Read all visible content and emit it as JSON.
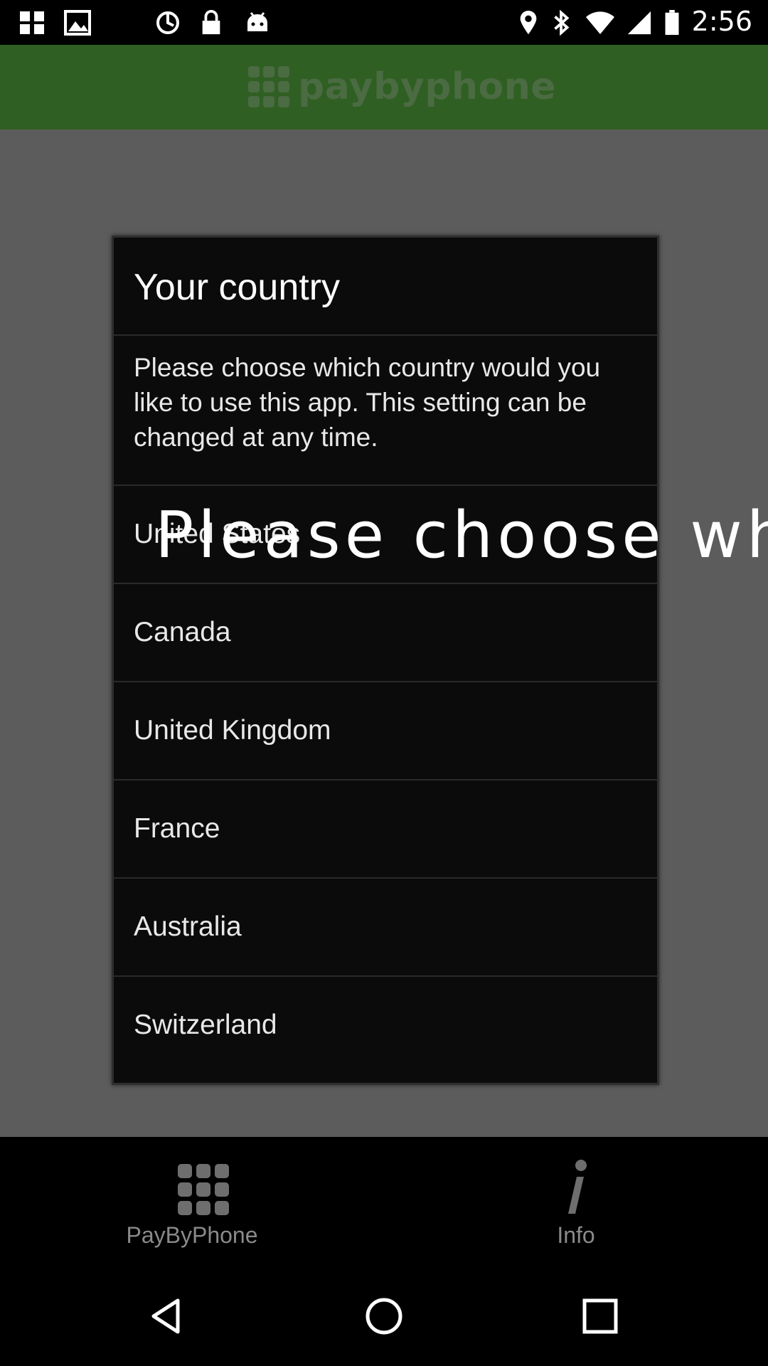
{
  "status_bar": {
    "time": "2:56",
    "left_icons": [
      "app-grid-icon",
      "image-icon",
      "sync-icon",
      "lock-icon",
      "android-icon"
    ],
    "right_icons": [
      "location-icon",
      "bluetooth-icon",
      "wifi-icon",
      "signal-icon",
      "battery-icon"
    ]
  },
  "header": {
    "logo_text": "paybyphone"
  },
  "dialog": {
    "title": "Your country",
    "message": "Please choose which country would you like to use this app. This setting can be changed at any time.",
    "options": [
      {
        "label": "United States"
      },
      {
        "label": "Canada"
      },
      {
        "label": "United Kingdom"
      },
      {
        "label": "France"
      },
      {
        "label": "Australia"
      },
      {
        "label": "Switzerland"
      }
    ]
  },
  "overlay_text": "Please choose which country would you like to use this app.",
  "tabs": [
    {
      "label": "PayByPhone",
      "icon": "grid-icon"
    },
    {
      "label": "Info",
      "icon": "info-icon"
    }
  ],
  "nav": {
    "buttons": [
      "back-icon",
      "home-icon",
      "recents-icon"
    ]
  },
  "colors": {
    "header_bg": "#2f5f22",
    "dialog_bg": "#0b0b0b",
    "scrim": "#5c5c5c"
  }
}
